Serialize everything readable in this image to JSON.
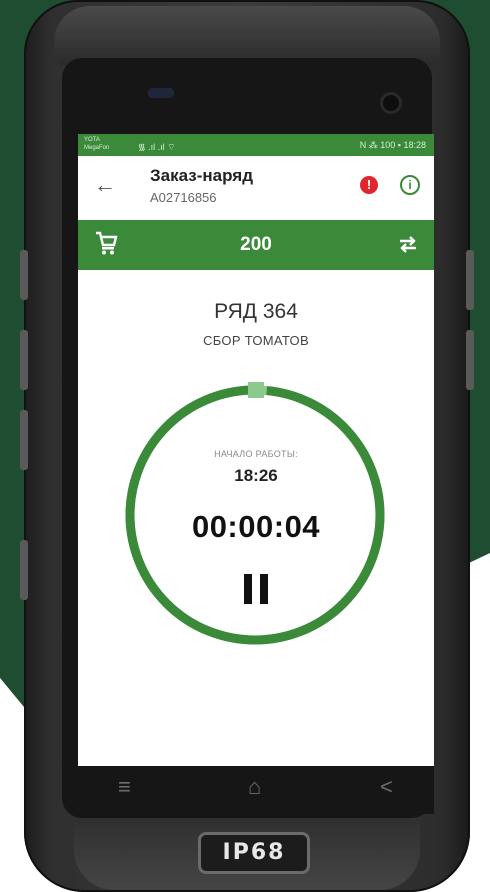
{
  "status_bar": {
    "carrier": "YOTA MegaFon",
    "signal": "᯾ .ıl .ıl ⌔",
    "right": "N ⁂ 100 ▪ 18:28"
  },
  "app_bar": {
    "title": "Заказ-наряд",
    "subtitle": "A02716856",
    "alert_icon": "!",
    "info_icon": "i"
  },
  "action_bar": {
    "count": "200",
    "cart_icon": "cart-icon",
    "swap_icon": "swap-arrows-icon"
  },
  "main": {
    "row_title": "РЯД 364",
    "row_subtitle": "СБОР ТОМАТОВ",
    "start_label": "НАЧАЛО РАБОТЫ:",
    "start_time": "18:26",
    "timer": "00:00:04",
    "progress_fraction": 0.98
  },
  "nav": {
    "menu": "≡",
    "home": "⌂",
    "back": "<"
  },
  "device_badge": "IP68",
  "colors": {
    "accent": "#3a8a3a",
    "alert": "#e0262b",
    "ring_track": "#8cc98c",
    "background": "#1f4d31"
  }
}
